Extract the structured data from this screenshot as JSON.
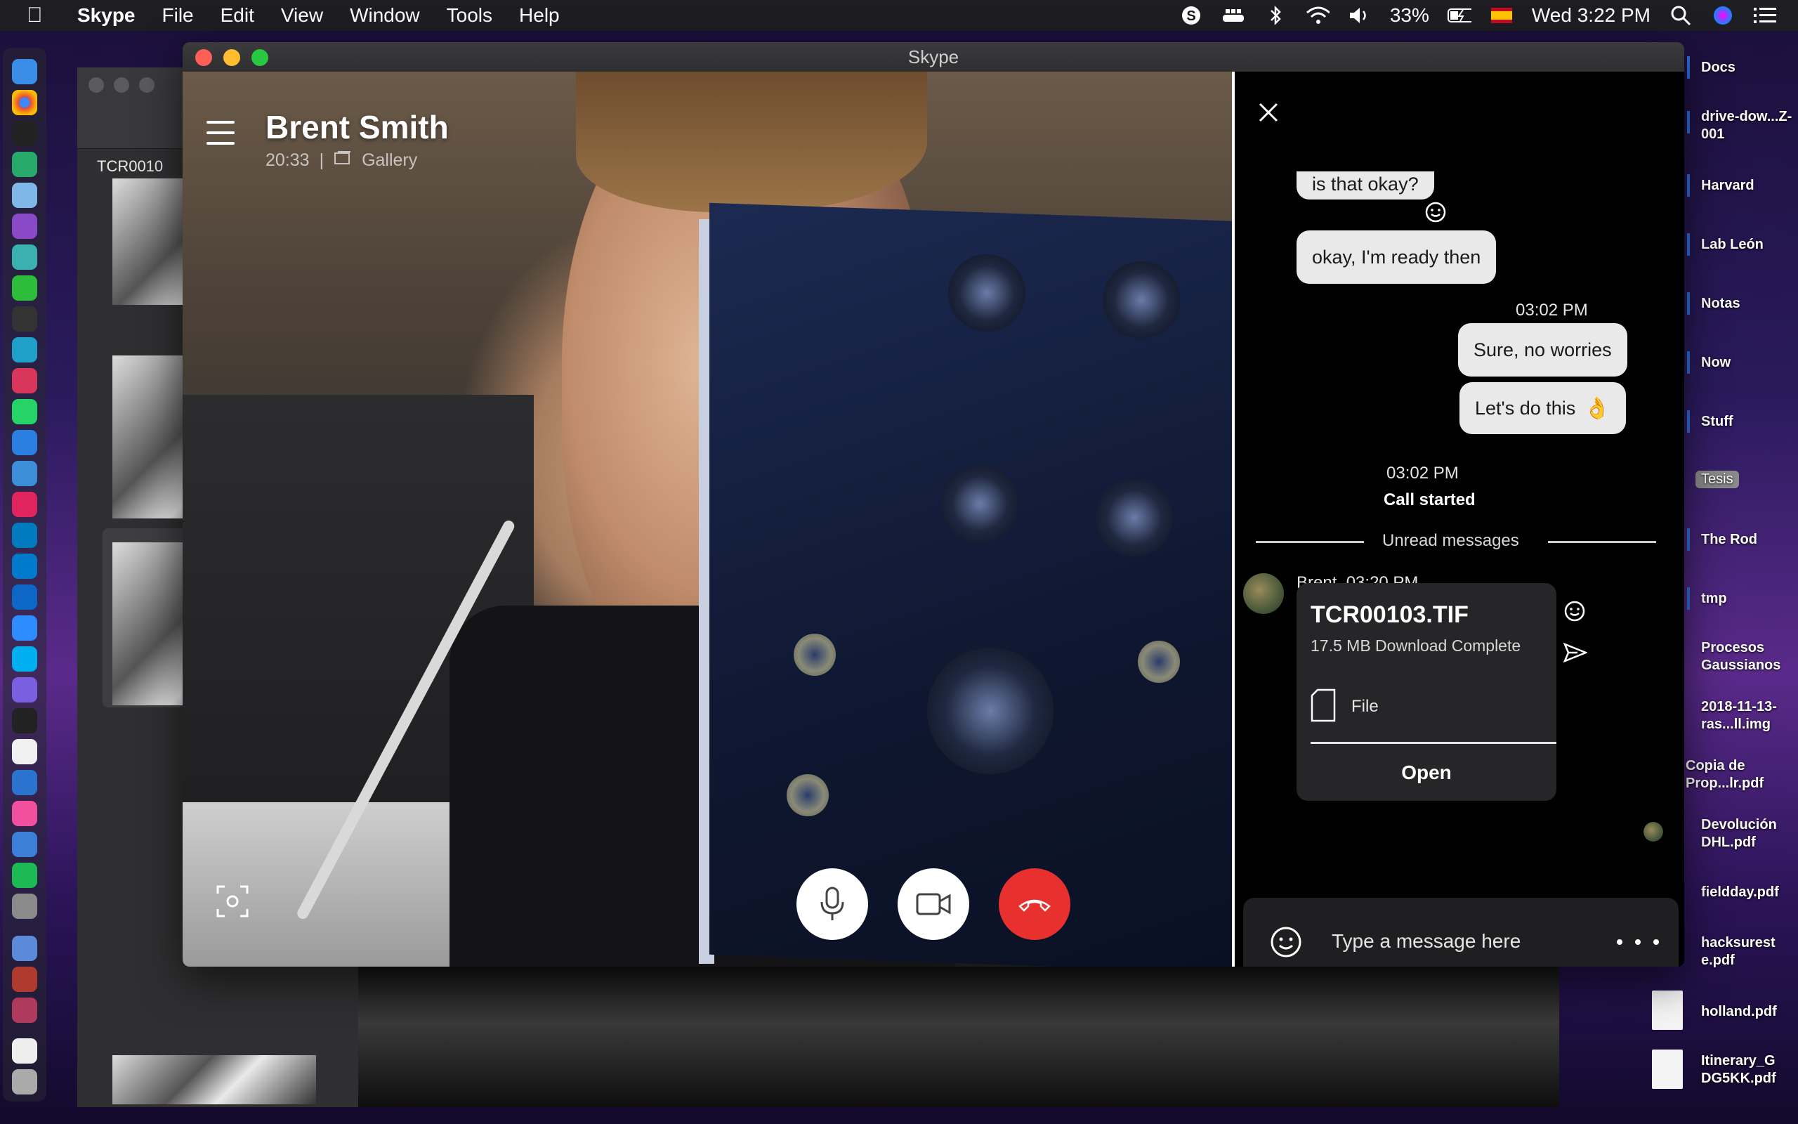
{
  "menubar": {
    "app_name": "Skype",
    "menus": [
      "File",
      "Edit",
      "View",
      "Window",
      "Tools",
      "Help"
    ],
    "battery": "33%",
    "clock": "Wed 3:22 PM"
  },
  "preview_window": {
    "tree_label": "TCR0010"
  },
  "desktop": {
    "items": [
      "Docs",
      "drive-dow...Z-001",
      "Harvard",
      "Lab León",
      "Notas",
      "Now",
      "Stuff",
      "Tesis",
      "The Rod",
      "tmp",
      "Procesos Gaussianos",
      "2018-11-13-ras...ll.img",
      "Copia de Prop...lr.pdf",
      "Devolución DHL.pdf",
      "fieldday.pdf",
      "hacksurest e.pdf",
      "holland.pdf",
      "Itinerary_G DG5KK.pdf"
    ]
  },
  "skype": {
    "window_title": "Skype",
    "call": {
      "contact_name": "Brent Smith",
      "duration": "20:33",
      "separator": "|",
      "view_mode": "Gallery"
    },
    "chat": {
      "partial_message": "is that okay?",
      "msg_ready": "okay, I'm ready then",
      "out_time": "03:02 PM",
      "msg_sure": "Sure, no worries",
      "msg_do_this": "Let's do this",
      "msg_do_this_emoji": "👌",
      "call_time": "03:02 PM",
      "call_started": "Call started",
      "unread_label": "Unread messages",
      "sender_line": "Brent, 03:20 PM",
      "file": {
        "name": "TCR00103.TIF",
        "status": "17.5 MB Download Complete",
        "type_label": "File",
        "open_label": "Open"
      },
      "composer_placeholder": "Type a message here"
    }
  },
  "colors": {
    "end_call_red": "#e8312f",
    "chat_bg": "#000000",
    "bubble": "#e9e9ea"
  }
}
